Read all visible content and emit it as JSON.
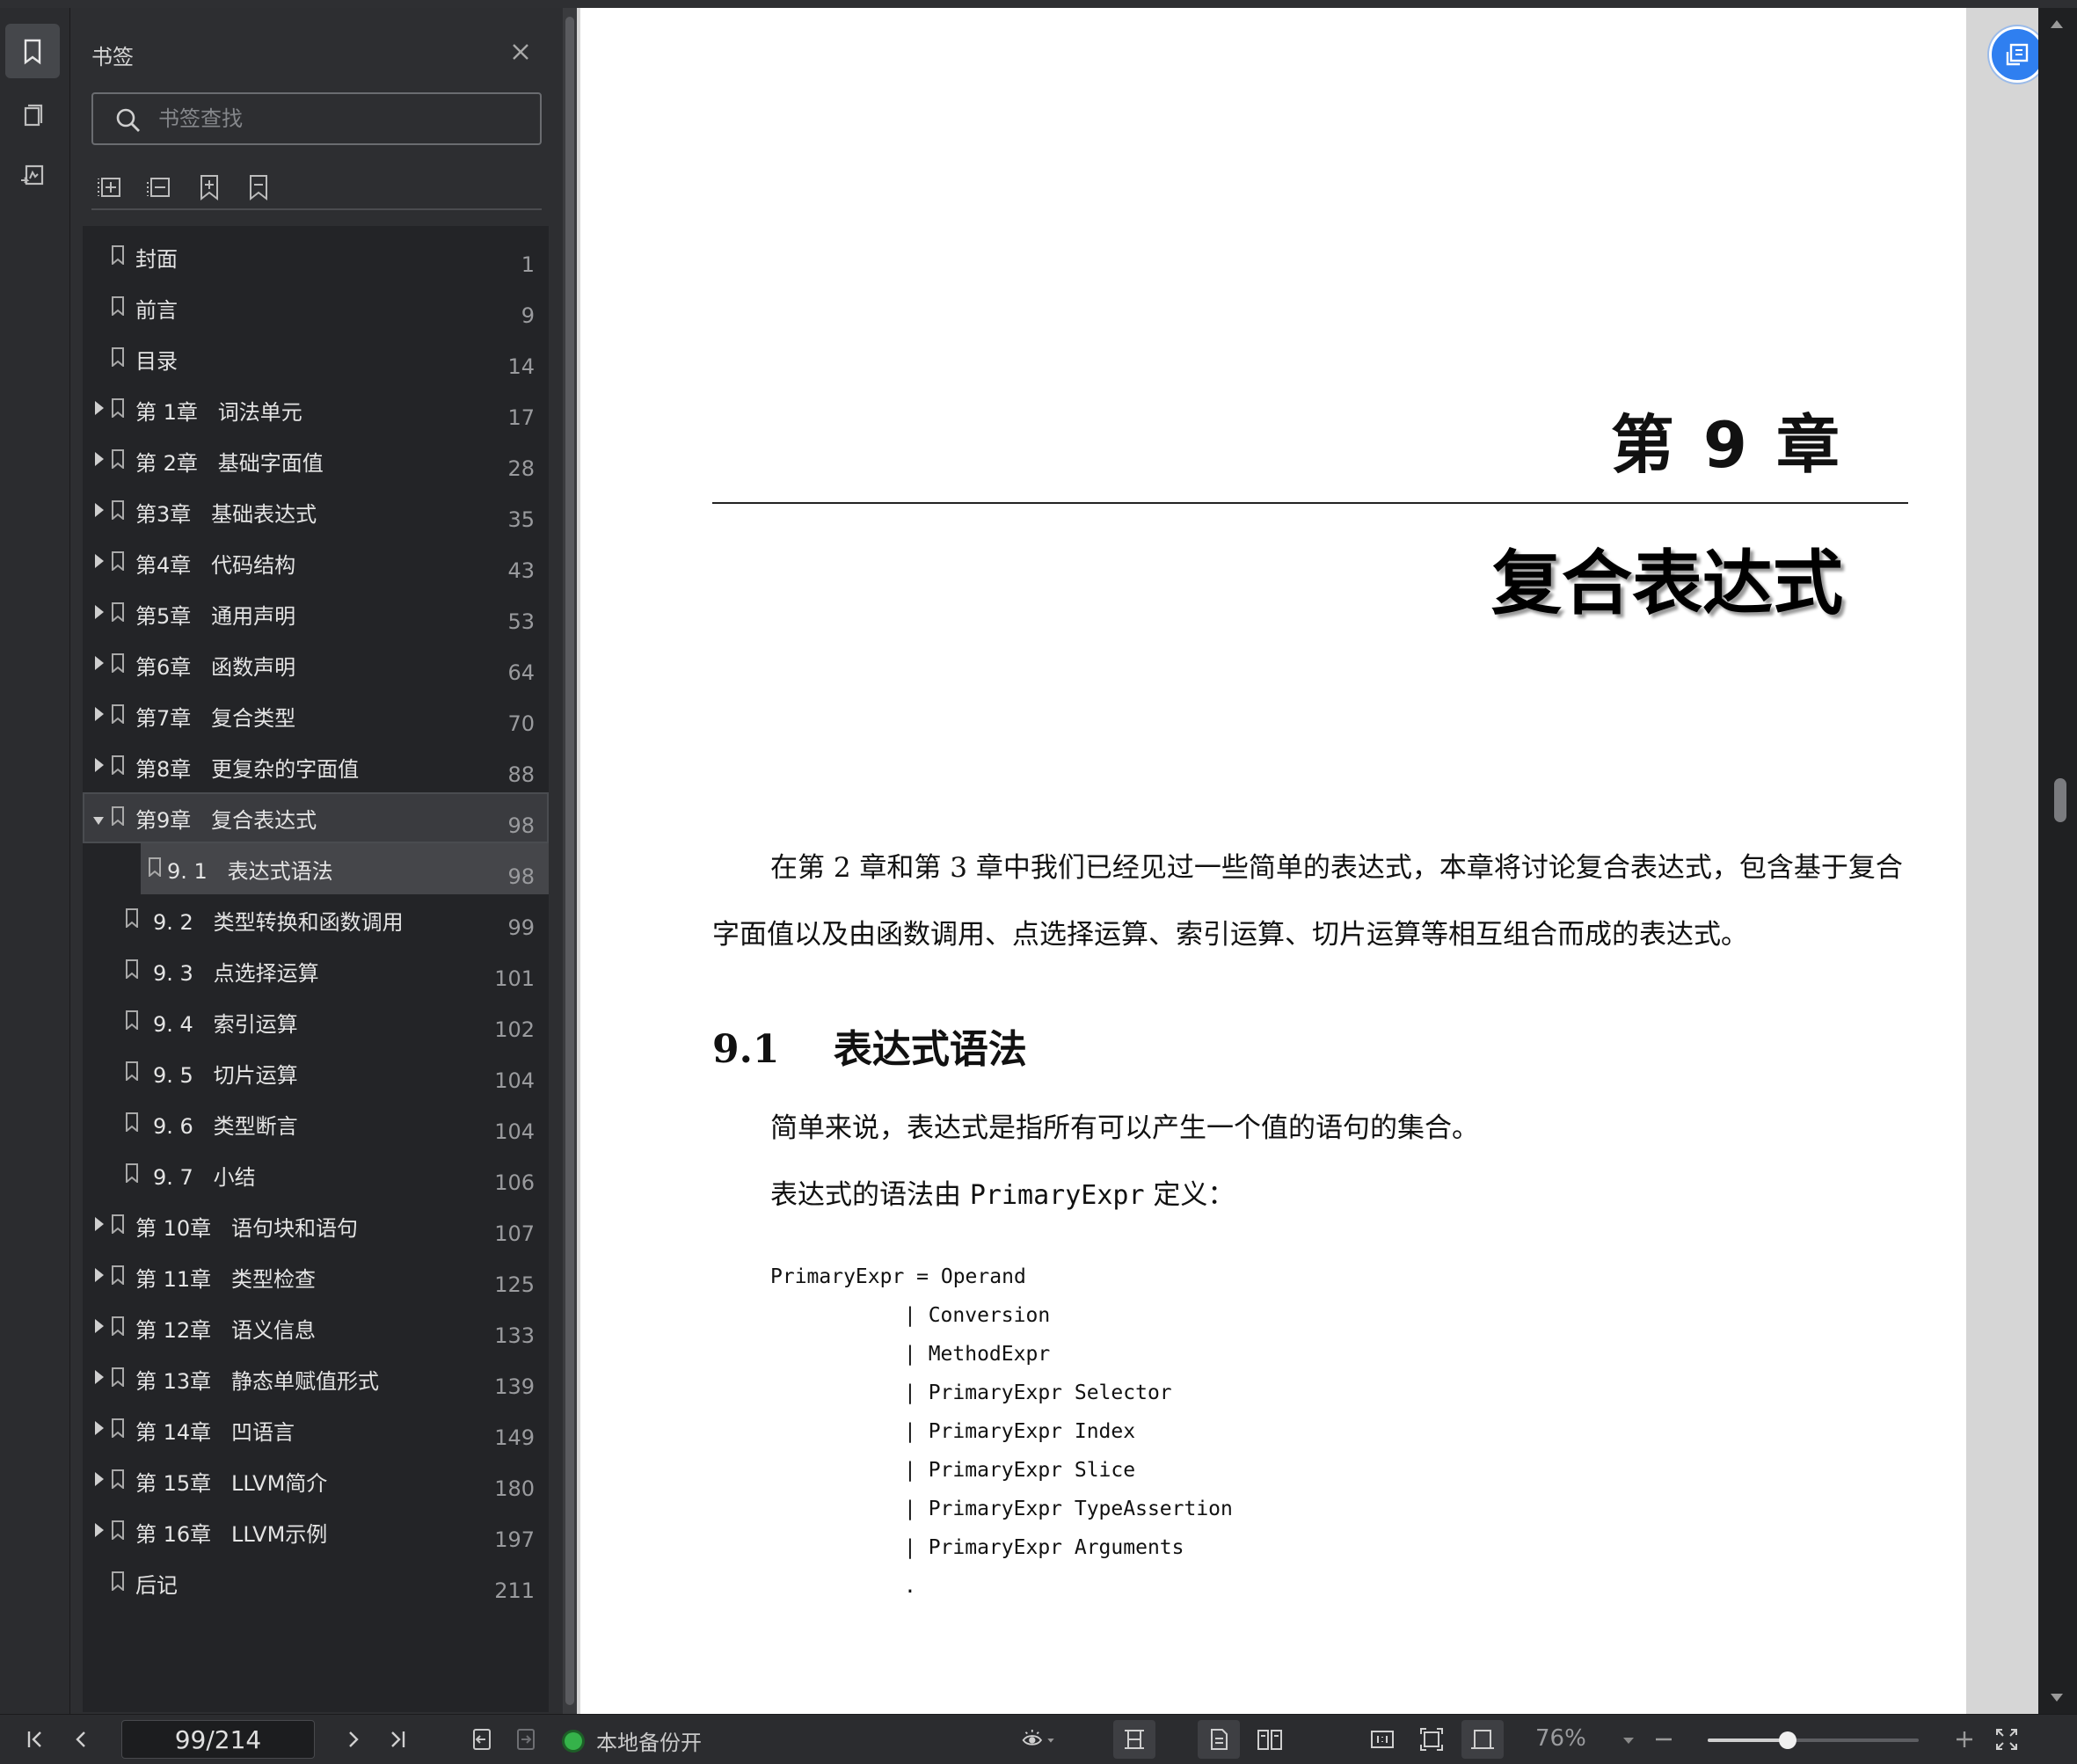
{
  "sidebar": {
    "title": "书签",
    "search_placeholder": "书签查找",
    "bookmarks": [
      {
        "label": "封面",
        "page": "1",
        "level": 0,
        "expandable": false
      },
      {
        "label": "前言",
        "page": "9",
        "level": 0,
        "expandable": false
      },
      {
        "label": "目录",
        "page": "14",
        "level": 0,
        "expandable": false
      },
      {
        "label": "第 1章   词法单元",
        "page": "17",
        "level": 0,
        "expandable": true
      },
      {
        "label": "第 2章   基础字面值",
        "page": "28",
        "level": 0,
        "expandable": true
      },
      {
        "label": "第3章   基础表达式",
        "page": "35",
        "level": 0,
        "expandable": true
      },
      {
        "label": "第4章   代码结构",
        "page": "43",
        "level": 0,
        "expandable": true
      },
      {
        "label": "第5章   通用声明",
        "page": "53",
        "level": 0,
        "expandable": true
      },
      {
        "label": "第6章   函数声明",
        "page": "64",
        "level": 0,
        "expandable": true
      },
      {
        "label": "第7章   复合类型",
        "page": "70",
        "level": 0,
        "expandable": true
      },
      {
        "label": "第8章   更复杂的字面值",
        "page": "88",
        "level": 0,
        "expandable": true
      },
      {
        "label": "第9章   复合表达式",
        "page": "98",
        "level": 0,
        "expandable": true,
        "expanded": true,
        "selected": true
      },
      {
        "label": "9. 1   表达式语法",
        "page": "98",
        "level": 1,
        "expandable": false,
        "current": true
      },
      {
        "label": "9. 2   类型转换和函数调用",
        "page": "99",
        "level": 1,
        "expandable": false
      },
      {
        "label": "9. 3   点选择运算",
        "page": "101",
        "level": 1,
        "expandable": false
      },
      {
        "label": "9. 4   索引运算",
        "page": "102",
        "level": 1,
        "expandable": false
      },
      {
        "label": "9. 5   切片运算",
        "page": "104",
        "level": 1,
        "expandable": false
      },
      {
        "label": "9. 6   类型断言",
        "page": "104",
        "level": 1,
        "expandable": false
      },
      {
        "label": "9. 7   小结",
        "page": "106",
        "level": 1,
        "expandable": false
      },
      {
        "label": "第 10章   语句块和语句",
        "page": "107",
        "level": 0,
        "expandable": true
      },
      {
        "label": "第 11章   类型检查",
        "page": "125",
        "level": 0,
        "expandable": true
      },
      {
        "label": "第 12章   语义信息",
        "page": "133",
        "level": 0,
        "expandable": true
      },
      {
        "label": "第 13章   静态单赋值形式",
        "page": "139",
        "level": 0,
        "expandable": true
      },
      {
        "label": "第 14章   凹语言",
        "page": "149",
        "level": 0,
        "expandable": true
      },
      {
        "label": "第 15章   LLVM简介",
        "page": "180",
        "level": 0,
        "expandable": true
      },
      {
        "label": "第 16章   LLVM示例",
        "page": "197",
        "level": 0,
        "expandable": true
      },
      {
        "label": "后记",
        "page": "211",
        "level": 0,
        "expandable": false
      }
    ]
  },
  "document": {
    "chapter_number": "第 9 章",
    "chapter_title": "复合表达式",
    "intro": "在第 2 章和第 3 章中我们已经见过一些简单的表达式，本章将讨论复合表达式，包含基于复合字面值以及由函数调用、点选择运算、索引运算、切片运算等相互组合而成的表达式。",
    "section_number": "9.1",
    "section_title": "表达式语法",
    "para1": "简单来说，表达式是指所有可以产生一个值的语句的集合。",
    "para2_pre": "表达式的语法由 ",
    "para2_code": "PrimaryExpr",
    "para2_post": " 定义：",
    "code_lines": [
      "PrimaryExpr = Operand",
      "| Conversion",
      "| MethodExpr",
      "| PrimaryExpr Selector",
      "| PrimaryExpr Index",
      "| PrimaryExpr Slice",
      "| PrimaryExpr TypeAssertion",
      "| PrimaryExpr Arguments",
      "."
    ]
  },
  "statusbar": {
    "page_indicator": "99/214",
    "backup_status": "本地备份开",
    "zoom": "76%",
    "zoom_fraction": 0.38
  },
  "colors": {
    "accent": "#2f7ff0",
    "status_ok": "#35b24a"
  }
}
